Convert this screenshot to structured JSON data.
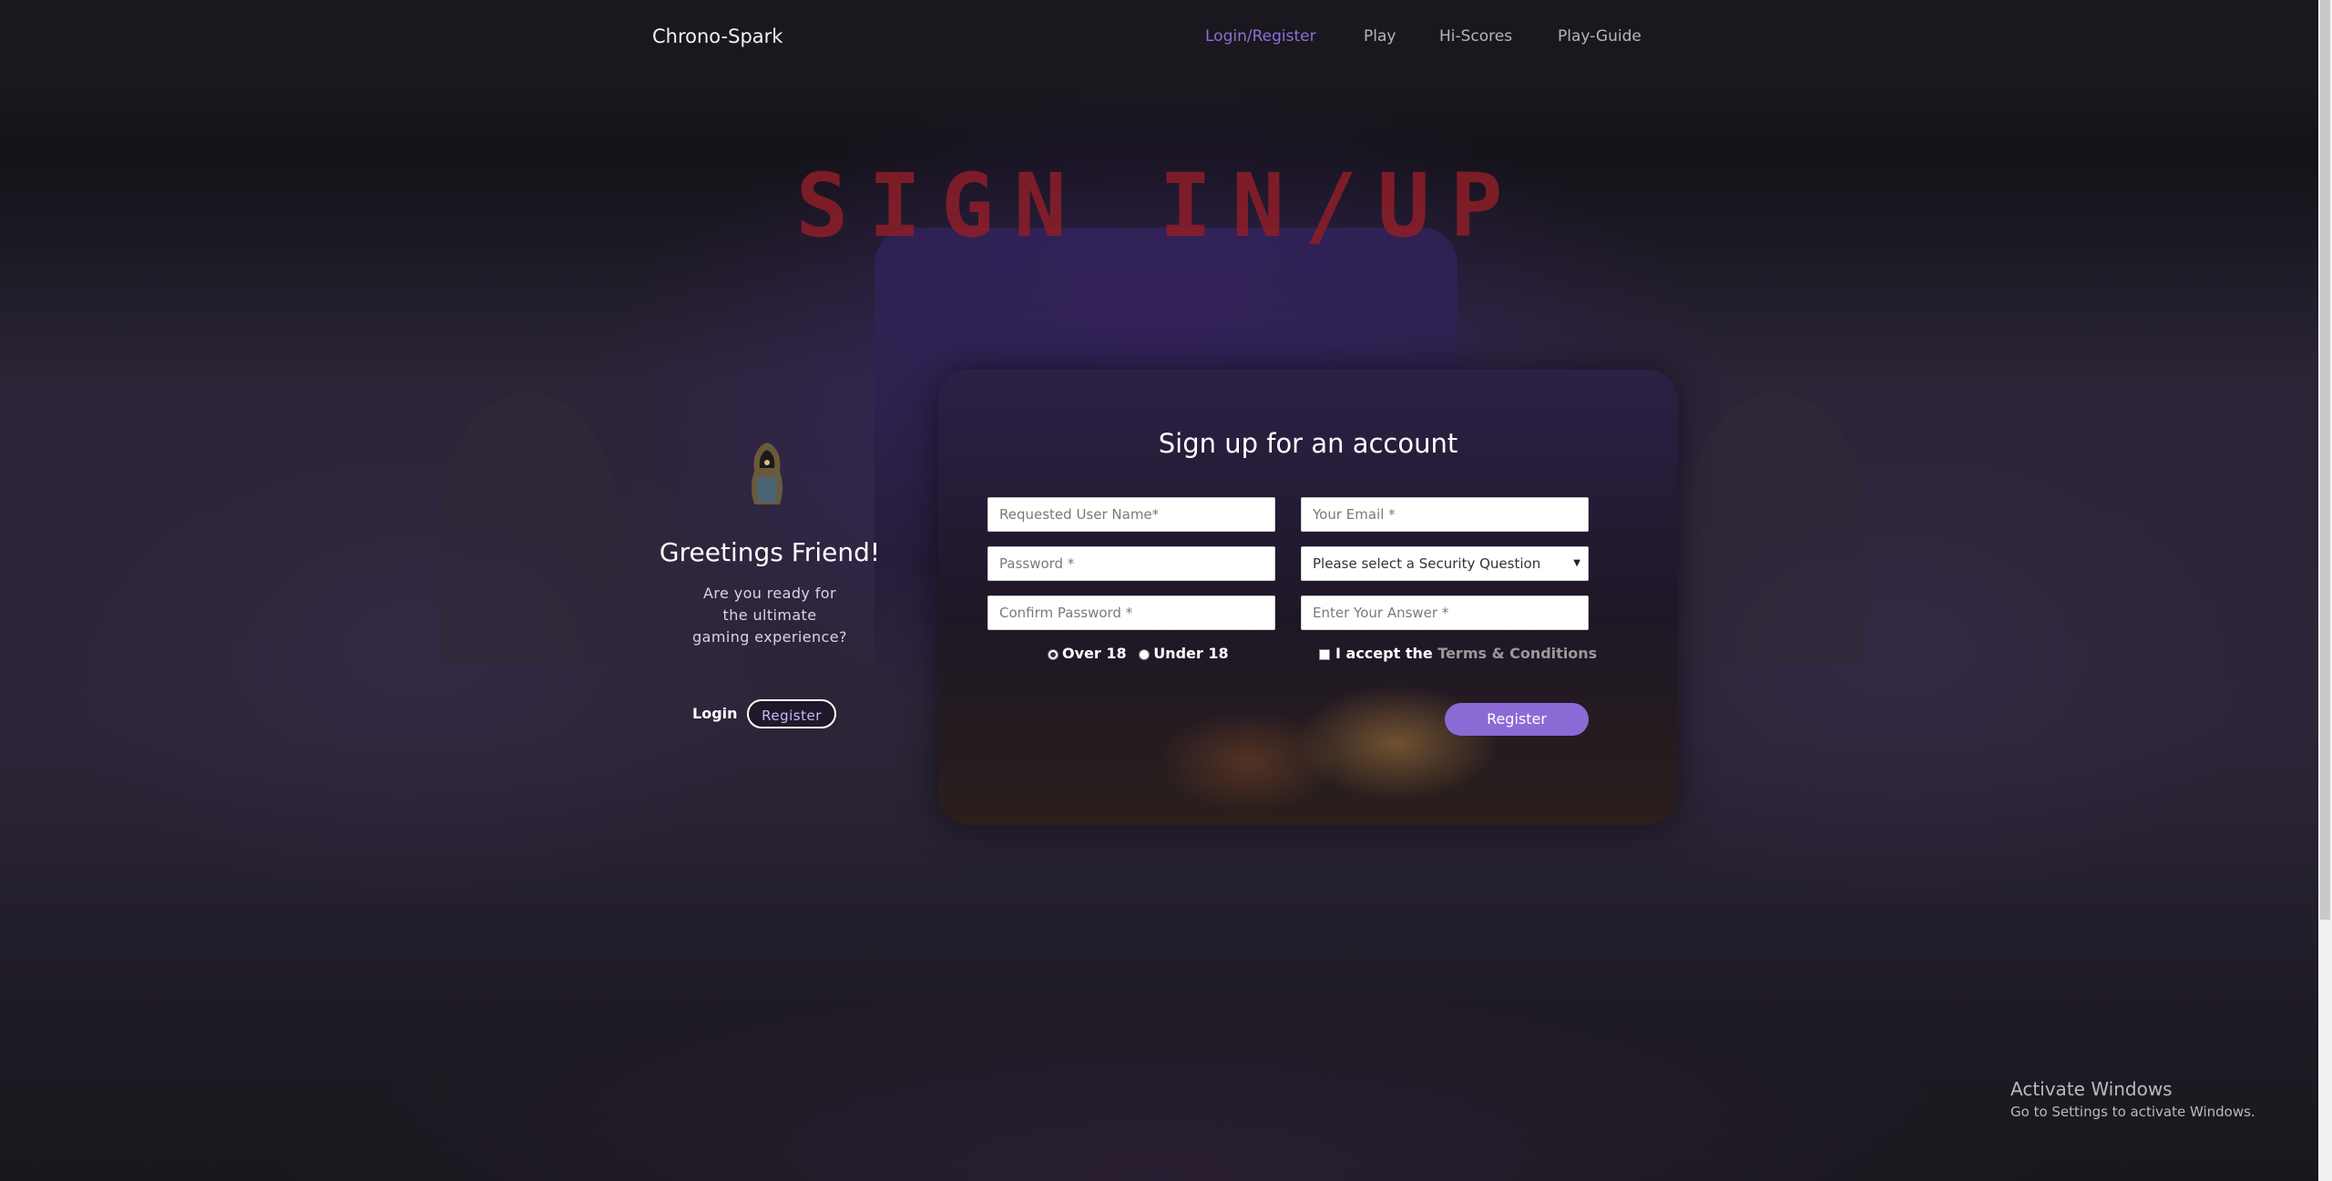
{
  "nav": {
    "brand": "Chrono-Spark",
    "links": [
      "Login/Register",
      "Play",
      "Hi-Scores",
      "Play-Guide"
    ],
    "active_color": "#8c6fd8"
  },
  "hero": {
    "title": "SIGN IN/UP"
  },
  "left_panel": {
    "avatar_icon": "hooded-figure-icon",
    "greeting": "Greetings Friend!",
    "subtitle": "Are you ready for the ultimate gaming experience?",
    "login_label": "Login",
    "register_label": "Register"
  },
  "form": {
    "title": "Sign up for an account",
    "username_placeholder": "Requested User Name*",
    "email_placeholder": "Your Email *",
    "password_placeholder": "Password *",
    "security_question_selected": "Please select a Security Question",
    "confirm_password_placeholder": "Confirm Password *",
    "answer_placeholder": "Enter Your Answer *",
    "age_options": [
      "Over 18",
      "Under 18"
    ],
    "age_selected": "Over 18",
    "terms_prefix": "I accept the",
    "terms_link": "Terms & Conditions",
    "submit_label": "Register",
    "accent_color": "#8a6bd6"
  },
  "watermark": {
    "line1": "Activate Windows",
    "line2": "Go to Settings to activate Windows."
  }
}
